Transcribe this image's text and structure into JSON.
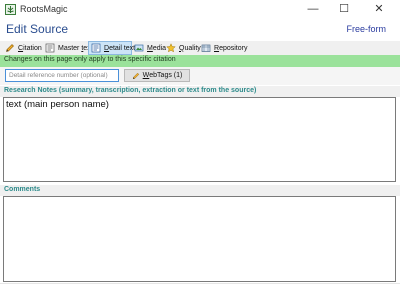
{
  "window": {
    "title": "RootsMagic",
    "minimize": "—",
    "maximize": "☐",
    "close": "✕"
  },
  "header": {
    "title": "Edit Source",
    "mode": "Free-form"
  },
  "tabs": [
    {
      "label": "Citation",
      "underline": "C",
      "rest": "itation",
      "icon": "pencil-icon",
      "active": false
    },
    {
      "label": "Master text",
      "underline": "",
      "rest": "",
      "icon": "document-icon",
      "active": false
    },
    {
      "label": "Detail text",
      "underline": "",
      "rest": "",
      "icon": "detail-document-icon",
      "active": true
    },
    {
      "label": "Media",
      "underline": "",
      "rest": "",
      "icon": "media-icon",
      "active": false
    },
    {
      "label": "Quality",
      "underline": "",
      "rest": "",
      "icon": "star-icon",
      "active": false
    },
    {
      "label": "Repository",
      "underline": "",
      "rest": "",
      "icon": "repository-icon",
      "active": false
    }
  ],
  "tab_parts": {
    "citation_u": "C",
    "citation_rest": "itation",
    "master_pre": "Master ",
    "master_u": "t",
    "master_rest": "ext",
    "detail_u": "D",
    "detail_rest": "etail text",
    "media_u": "M",
    "media_rest": "edia",
    "quality_u": "Q",
    "quality_rest": "uality",
    "repository_u": "R",
    "repository_rest": "epository"
  },
  "notice": {
    "text": "Changes on this page only apply to this specific citation"
  },
  "reference": {
    "placeholder": "Detail reference number (optional)",
    "value": ""
  },
  "webtags": {
    "label_u": "W",
    "label_rest": "ebTags (1)"
  },
  "research_notes": {
    "header": "Research Notes (summary, transcription, extraction or text from the source)",
    "text": "text (main person name)"
  },
  "comments": {
    "header": "Comments",
    "text": ""
  },
  "colors": {
    "notice_bg": "#9be29b",
    "section_header": "#2e8b8b",
    "title_blue": "#2a4d8f",
    "active_tab": "#cce4f7"
  }
}
